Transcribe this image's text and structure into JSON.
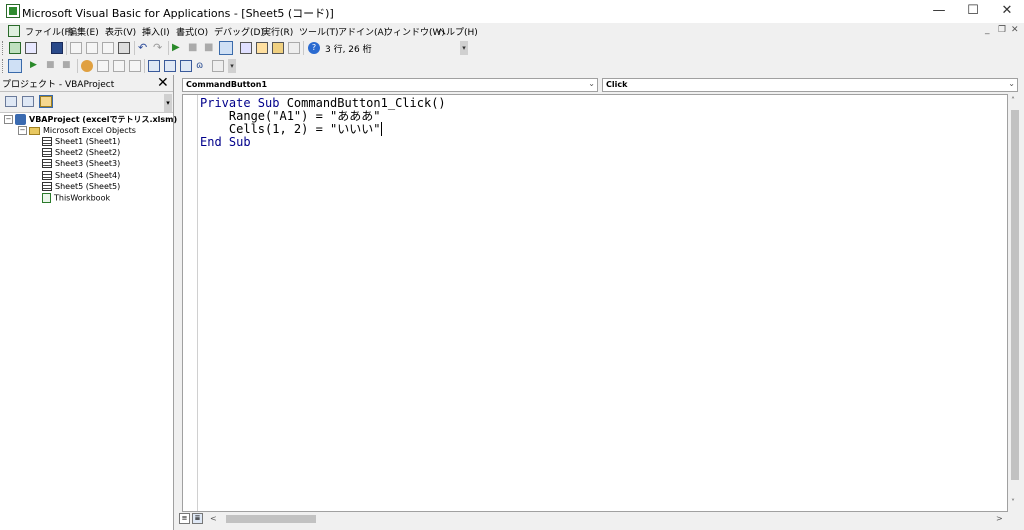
{
  "window": {
    "title": "Microsoft Visual Basic for Applications - [Sheet5 (コード)]",
    "minimize": "—",
    "maximize": "☐",
    "close": "✕"
  },
  "menu": {
    "items": [
      "ファイル(F)",
      "編集(E)",
      "表示(V)",
      "挿入(I)",
      "書式(O)",
      "デバッグ(D)",
      "実行(R)",
      "ツール(T)",
      "アドイン(A)",
      "ウィンドウ(W)",
      "ヘルプ(H)"
    ],
    "mdi_minimize": "_",
    "mdi_restore": "❐",
    "mdi_close": "✕"
  },
  "toolbar": {
    "cursor_position": "3 行, 26 桁",
    "icons": [
      "excel-icon",
      "insert-userform-icon",
      "save-icon",
      "cut-icon",
      "copy-icon",
      "paste-icon",
      "find-icon",
      "undo-icon",
      "redo-icon",
      "run-icon",
      "break-icon",
      "reset-icon",
      "design-mode-icon",
      "project-explorer-icon",
      "properties-icon",
      "object-browser-icon",
      "toolbox-icon",
      "help-icon"
    ]
  },
  "project": {
    "title": "プロジェクト - VBAProject",
    "close": "✕",
    "tree": {
      "root": "VBAProject (excelでテトリス.xlsm)",
      "folder": "Microsoft Excel Objects",
      "items": [
        "Sheet1 (Sheet1)",
        "Sheet2 (Sheet2)",
        "Sheet3 (Sheet3)",
        "Sheet4 (Sheet4)",
        "Sheet5 (Sheet5)",
        "ThisWorkbook"
      ]
    }
  },
  "code": {
    "object_combo": "CommandButton1",
    "procedure_combo": "Click",
    "lines": [
      {
        "kw": "Private Sub ",
        "text": "CommandButton1_Click()"
      },
      {
        "kw": "",
        "text": "    Range(\"A1\") = \"あああ\""
      },
      {
        "kw": "",
        "text": "    Cells(1, 2) = \"いいい\""
      },
      {
        "kw": "End Sub",
        "text": ""
      }
    ]
  }
}
